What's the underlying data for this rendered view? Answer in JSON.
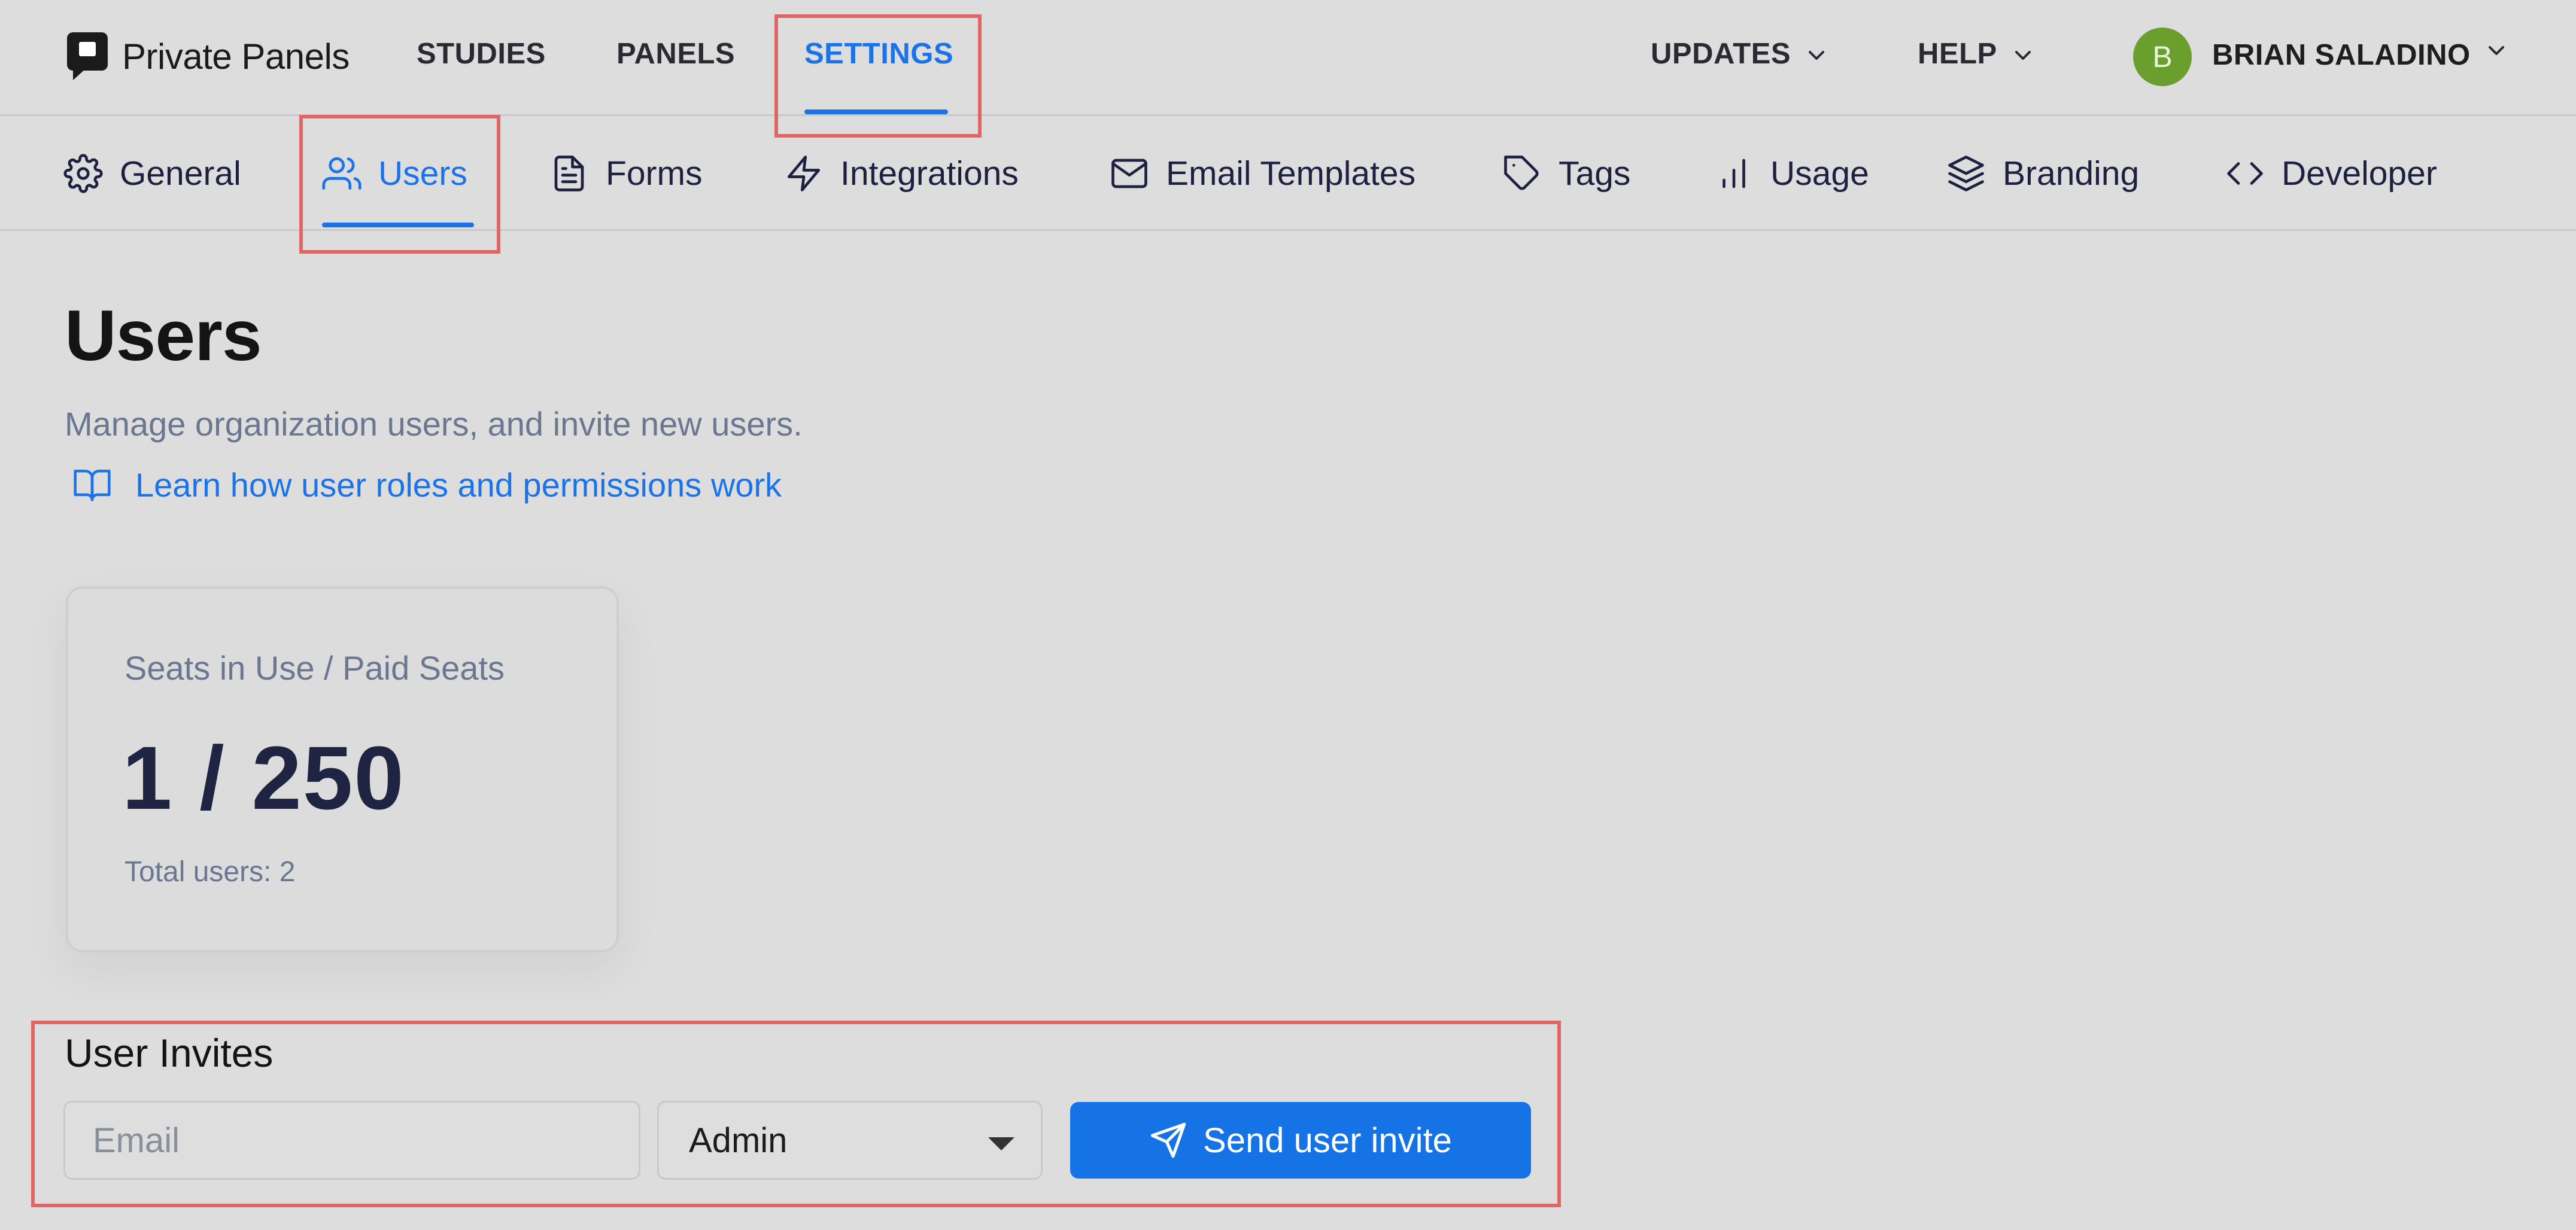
{
  "brand": {
    "name": "Private Panels"
  },
  "topnav": {
    "links": [
      {
        "label": "STUDIES"
      },
      {
        "label": "PANELS"
      },
      {
        "label": "SETTINGS",
        "active": true
      }
    ],
    "updates_label": "UPDATES",
    "help_label": "HELP",
    "user": {
      "initial": "B",
      "name": "BRIAN SALADINO",
      "avatar_color": "#6a9f2e"
    }
  },
  "settings_tabs": [
    {
      "label": "General",
      "icon": "gear-icon"
    },
    {
      "label": "Users",
      "icon": "users-icon",
      "active": true
    },
    {
      "label": "Forms",
      "icon": "document-icon"
    },
    {
      "label": "Integrations",
      "icon": "lightning-icon"
    },
    {
      "label": "Email Templates",
      "icon": "mail-icon"
    },
    {
      "label": "Tags",
      "icon": "tag-icon"
    },
    {
      "label": "Usage",
      "icon": "bar-chart-icon"
    },
    {
      "label": "Branding",
      "icon": "layers-icon"
    },
    {
      "label": "Developer",
      "icon": "code-icon"
    }
  ],
  "page": {
    "title": "Users",
    "subtitle": "Manage organization users, and invite new users.",
    "learn_link": "Learn how user roles and permissions work"
  },
  "seats_card": {
    "label": "Seats in Use / Paid Seats",
    "value": "1 / 250",
    "total": "Total users: 2"
  },
  "invites": {
    "title": "User Invites",
    "email_placeholder": "Email",
    "email_value": "",
    "role_selected": "Admin",
    "send_label": "Send user invite"
  },
  "colors": {
    "accent": "#1a73e8",
    "highlight_box": "#e06666",
    "background": "#dddddd"
  }
}
